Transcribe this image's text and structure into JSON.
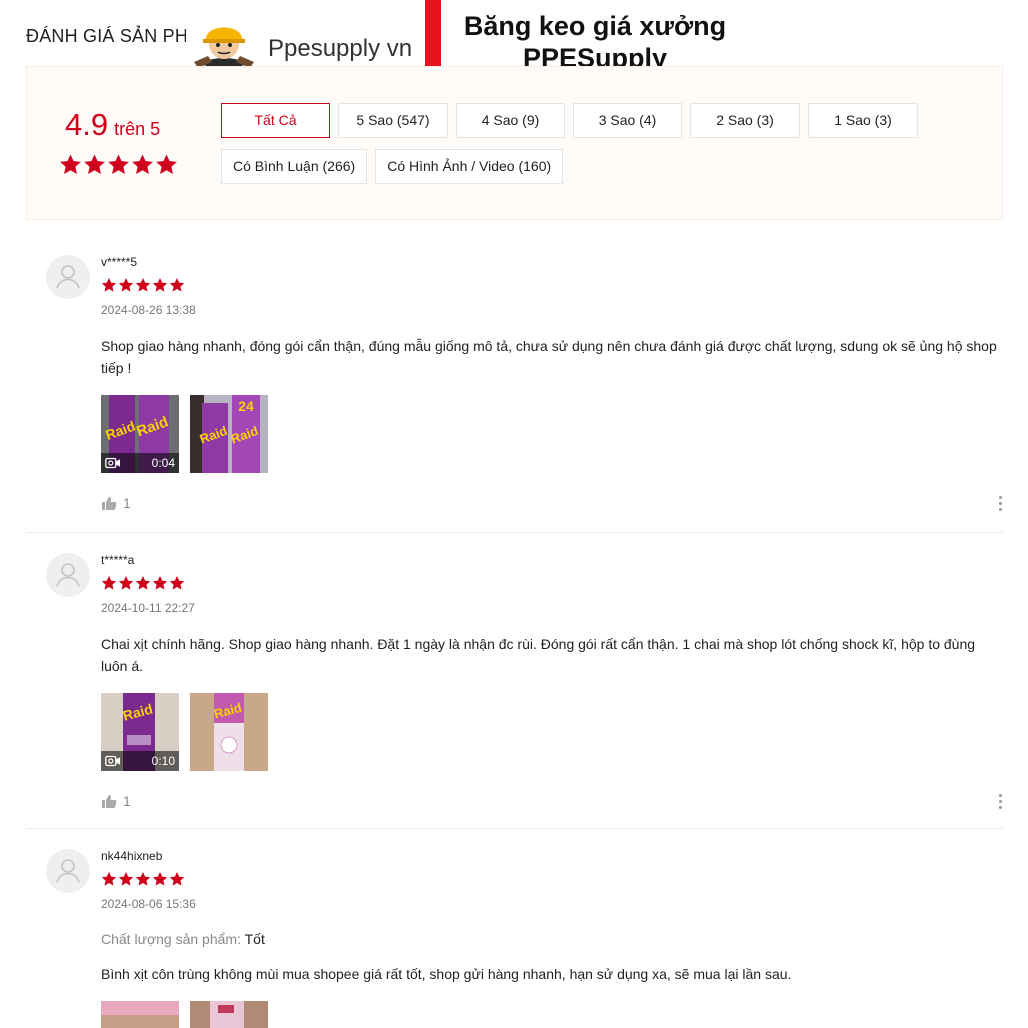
{
  "header": {
    "title": "ĐÁNH GIÁ SẢN PHẨM"
  },
  "watermark": {
    "brand": "Ppesupply vn",
    "headline_line1": "Băng keo giá xưởng",
    "headline_line2": "PPESupply",
    "accent_color": "#e8141d"
  },
  "summary": {
    "score": "4.9",
    "score_suffix": "trên 5",
    "stars": 5,
    "filters": [
      {
        "label": "Tất Cả",
        "active": true
      },
      {
        "label": "5 Sao (547)"
      },
      {
        "label": "4 Sao (9)"
      },
      {
        "label": "3 Sao (4)"
      },
      {
        "label": "2 Sao (3)"
      },
      {
        "label": "1 Sao (3)"
      },
      {
        "label": "Có Bình Luận (266)"
      },
      {
        "label": "Có Hình Ảnh / Video (160)"
      }
    ]
  },
  "reviews": [
    {
      "username": "v*****5",
      "rating": 5,
      "date": "2024-08-26 13:38",
      "comment": "Shop giao hàng nhanh, đóng gói cẩn thận, đúng mẫu giống mô tả, chưa sử dụng nên chưa đánh giá được chất lượng, sdung ok sẽ ủng hộ shop tiếp !",
      "video_duration": "0:04",
      "likes": "1"
    },
    {
      "username": "t*****a",
      "rating": 5,
      "date": "2024-10-11 22:27",
      "comment": "Chai xịt chính hãng. Shop giao hàng nhanh. Đặt 1 ngày là nhận đc rùi. Đóng gói rất cẩn thận. 1 chai mà shop lót chống shock kĩ, hộp to đùng luôn á.",
      "video_duration": "0:10",
      "likes": "1"
    },
    {
      "username": "nk44hixneb",
      "rating": 5,
      "date": "2024-08-06 15:36",
      "quality_label": "Chất lượng sản phẩm:",
      "quality_value": "Tốt",
      "comment": "Bình xịt côn trùng không mùi mua shopee giá rất tốt, shop gửi hàng nhanh, hạn sử dụng xa, sẽ mua lại lần sau."
    }
  ],
  "colors": {
    "primary": "#d0011b",
    "summary_bg": "#fffbf8",
    "muted": "#888888"
  },
  "icons": [
    "star-icon",
    "avatar-placeholder-icon",
    "video-camera-icon",
    "thumbs-up-icon",
    "more-options-icon"
  ]
}
